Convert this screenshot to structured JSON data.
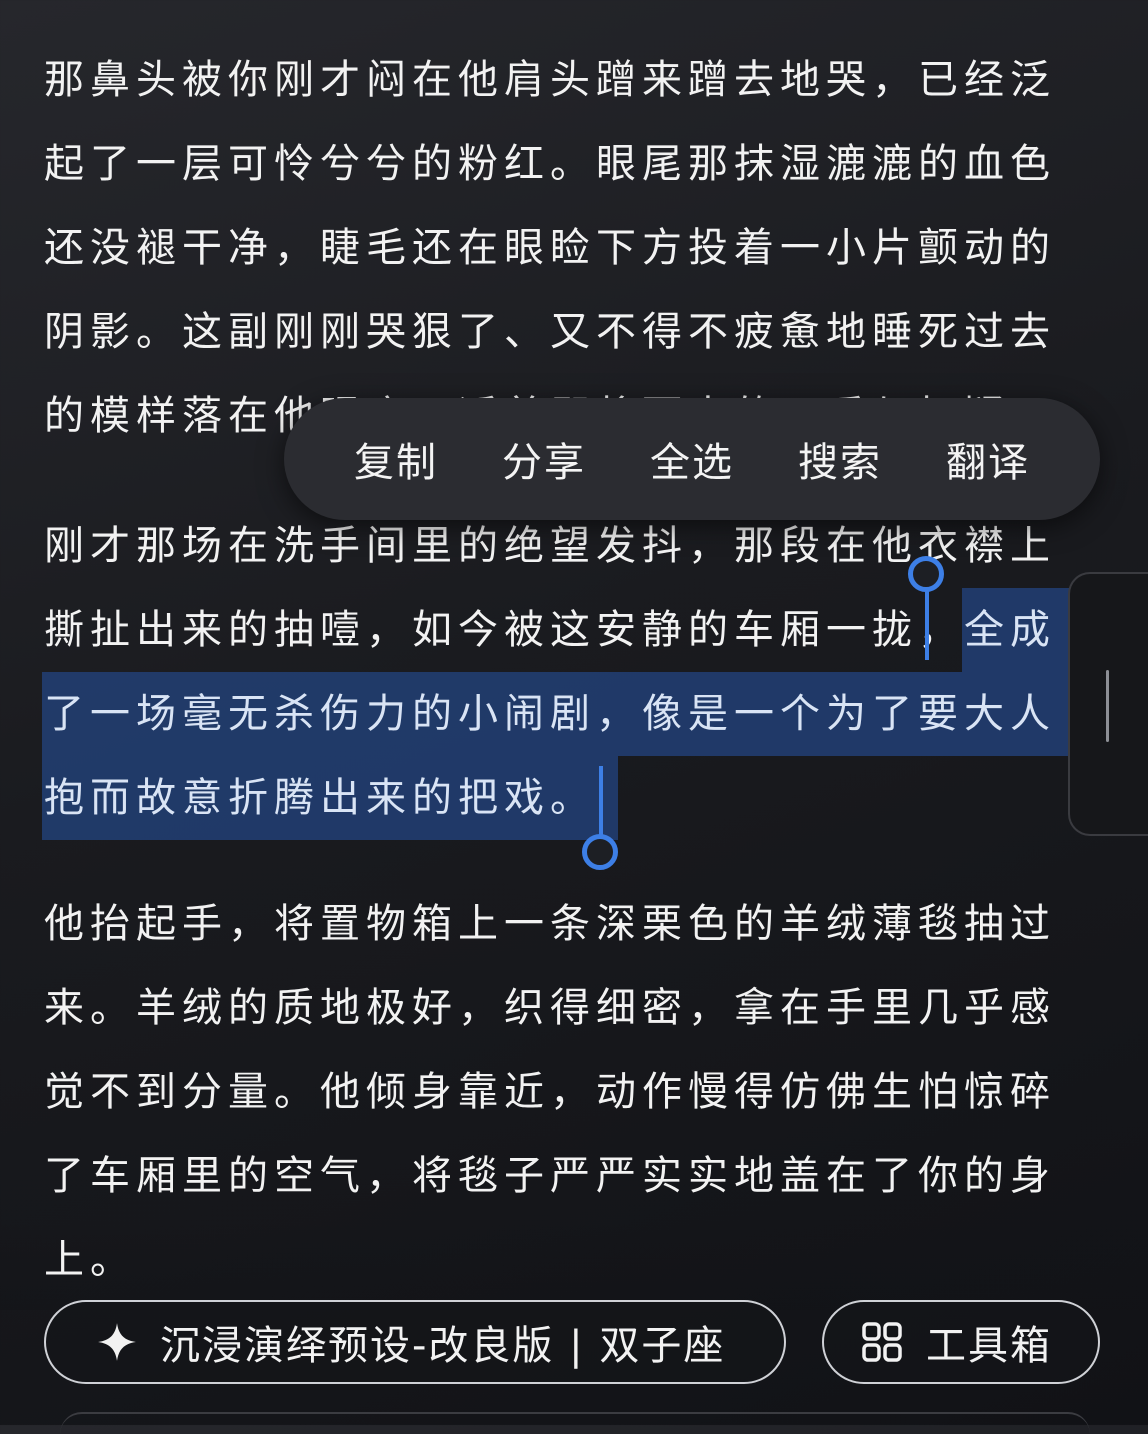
{
  "reader": {
    "p1": {
      "l1": "那鼻头被你刚才闷在他肩头蹭来蹭去地哭，已经泛",
      "l2": "起了一层可怜兮兮的粉红。眼尾那抹湿漉漉的血色",
      "l3": "还没褪干净，睫毛还在眼睑下方投着一小片颤动的",
      "l4": "阴影。这副刚刚哭狠了、又不得不疲惫地睡死过去",
      "l5": "的模样落在他眼底，适着即将而出的下垂与怀疑"
    },
    "p2": {
      "l1": "刚才那场在洗手间里的绝望发抖，那段在他衣襟上",
      "l2_plain": "撕扯出来的抽噎，如今被这安静的车厢一拢，",
      "l2_sel": "全成",
      "l3_sel": "了一场毫无杀伤力的小闹剧，像是一个为了要大人",
      "l4_sel": "抱而故意折腾出来的把戏。"
    },
    "p3": {
      "l1": "他抬起手，将置物箱上一条深栗色的羊绒薄毯抽过",
      "l2": "来。羊绒的质地极好，织得细密，拿在手里几乎感",
      "l3": "觉不到分量。他倾身靠近，动作慢得仿佛生怕惊碎",
      "l4": "了车厢里的空气，将毯子严严实实地盖在了你的身",
      "l5": "上。"
    }
  },
  "context_menu": {
    "copy": "复制",
    "share": "分享",
    "select_all": "全选",
    "search": "搜索",
    "translate": "翻译"
  },
  "bottom_bar": {
    "preset_label": "沉浸演绎预设-改良版 | 双子座",
    "preset_icon": "sparkle-icon",
    "toolbox_label": "工具箱",
    "toolbox_icon": "grid-icon"
  },
  "colors": {
    "selection": "#224076",
    "handle": "#3d7fe6",
    "menu_bg": "#2b2c31"
  }
}
